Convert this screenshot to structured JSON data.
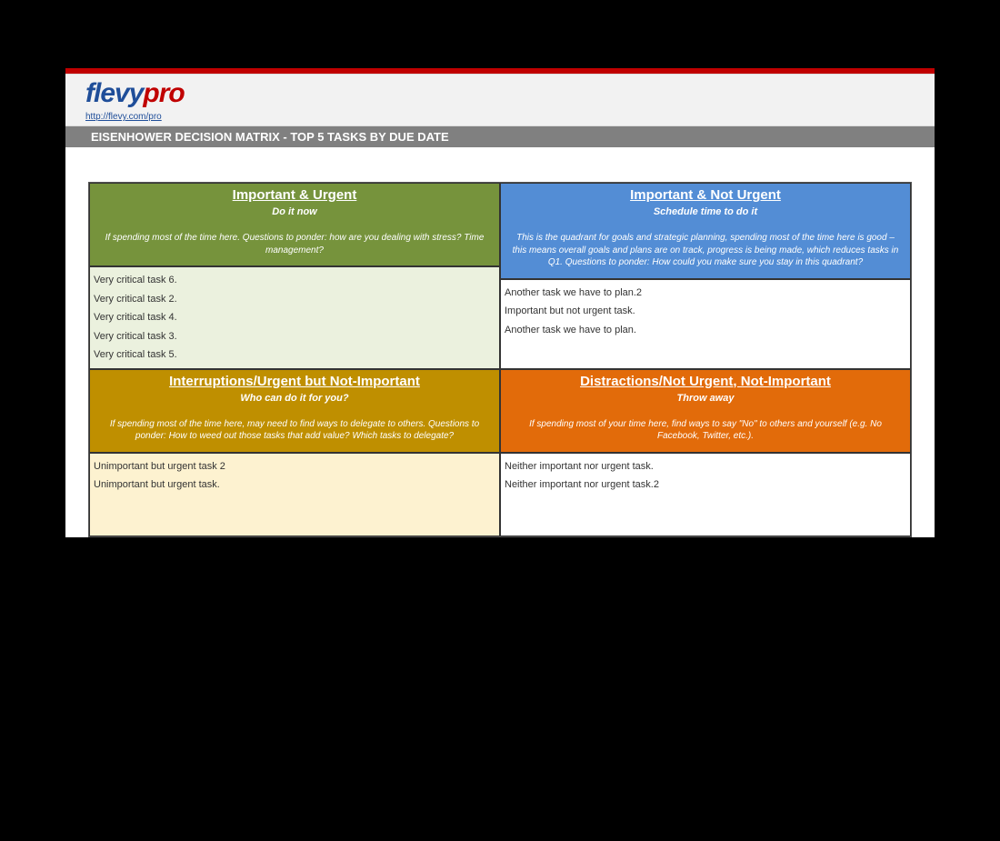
{
  "header": {
    "logo_part1": "flevy",
    "logo_part2": "pro",
    "url": "http://flevy.com/pro"
  },
  "title": "EISENHOWER DECISION MATRIX - TOP 5 TASKS BY DUE DATE",
  "quadrants": [
    {
      "title": "Important & Urgent",
      "subtitle": "Do it now",
      "description": "If spending most of the time here. Questions to ponder: how are you dealing with stress? Time management?",
      "tasks": [
        "Very critical task 6.",
        "Very critical task 2.",
        "Very critical task 4.",
        "Very critical task 3.",
        "Very critical task 5."
      ]
    },
    {
      "title": "Important & Not Urgent",
      "subtitle": "Schedule time to do it",
      "description": "This is the quadrant for goals and strategic planning, spending most of the time here is good – this means overall goals and plans are on track, progress is being made, which reduces tasks in Q1. Questions to ponder: How could you make sure you stay in this quadrant?",
      "tasks": [
        "Another task we have to plan.2",
        "Important but not urgent task.",
        "Another task we have to plan."
      ]
    },
    {
      "title": "Interruptions/Urgent but Not-Important",
      "subtitle": "Who can do it for you?",
      "description": "If spending most of the time here, may need to find ways to delegate to others. Questions to ponder: How to weed out those tasks that add value? Which tasks to delegate?",
      "tasks": [
        "Unimportant but urgent task 2",
        "Unimportant but urgent task."
      ]
    },
    {
      "title": "Distractions/Not Urgent, Not-Important",
      "subtitle": "Throw away",
      "description": "If spending most of your time here, find ways to say \"No\" to others and yourself (e.g. No Facebook, Twitter, etc.).",
      "tasks": [
        "Neither important nor urgent task.",
        "Neither important nor urgent task.2"
      ]
    }
  ]
}
